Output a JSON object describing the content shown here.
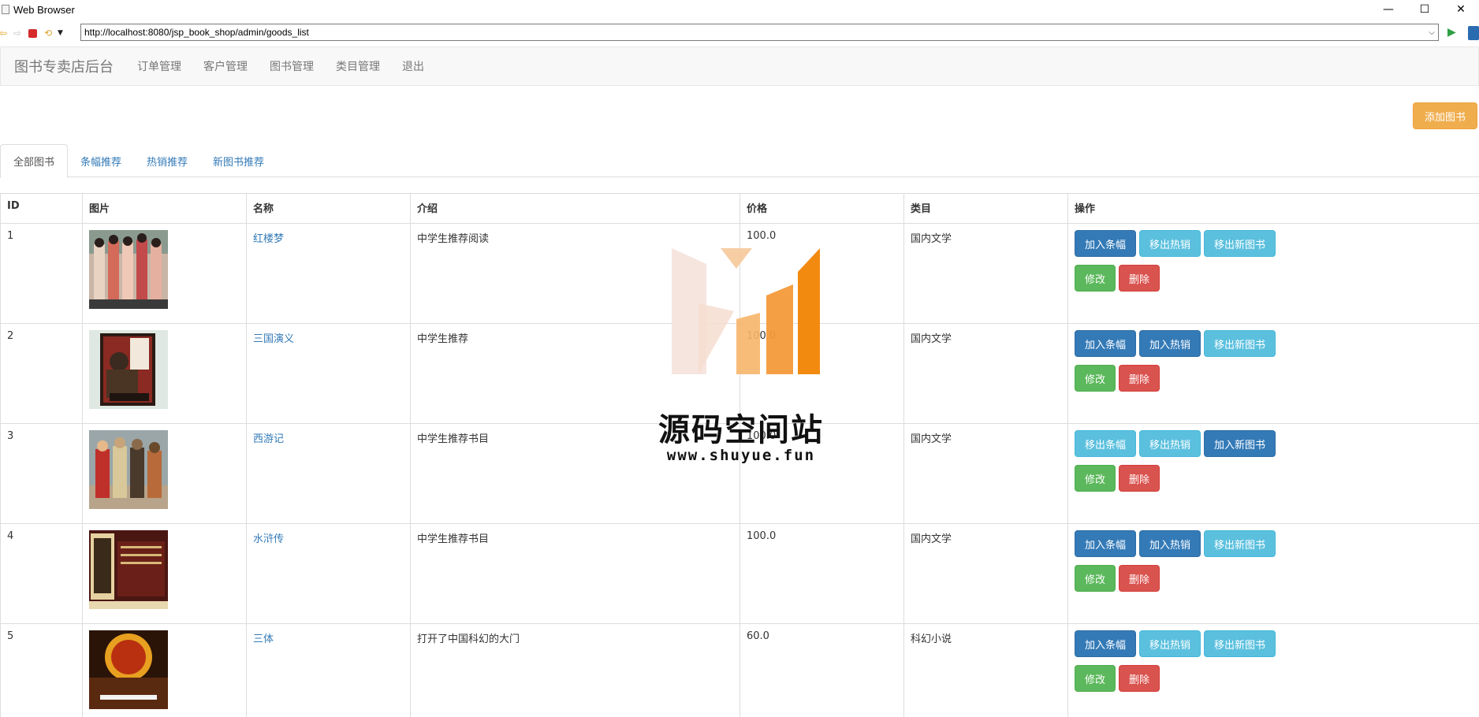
{
  "window": {
    "title": "Web Browser",
    "controls": [
      "—",
      "☐",
      "✕"
    ]
  },
  "browser": {
    "url": "http://localhost:8080/jsp_book_shop/admin/goods_list"
  },
  "navbar": {
    "brand": "图书专卖店后台",
    "links": [
      "订单管理",
      "客户管理",
      "图书管理",
      "类目管理",
      "退出"
    ]
  },
  "actions": {
    "add_book": "添加图书"
  },
  "tabs": [
    "全部图书",
    "条幅推荐",
    "热销推荐",
    "新图书推荐"
  ],
  "table": {
    "headers": [
      "ID",
      "图片",
      "名称",
      "介绍",
      "价格",
      "类目",
      "操作"
    ],
    "rows": [
      {
        "id": "1",
        "name": "红楼梦",
        "intro": "中学生推荐阅读",
        "price": "100.0",
        "category": "国内文学",
        "buttons": [
          "加入条幅",
          "移出热销",
          "移出新图书",
          "修改",
          "删除"
        ]
      },
      {
        "id": "2",
        "name": "三国演义",
        "intro": "中学生推荐",
        "price": "100.0",
        "category": "国内文学",
        "buttons": [
          "加入条幅",
          "加入热销",
          "移出新图书",
          "修改",
          "删除"
        ]
      },
      {
        "id": "3",
        "name": "西游记",
        "intro": "中学生推荐书目",
        "price": "100.0",
        "category": "国内文学",
        "buttons": [
          "移出条幅",
          "移出热销",
          "加入新图书",
          "修改",
          "删除"
        ]
      },
      {
        "id": "4",
        "name": "水浒传",
        "intro": "中学生推荐书目",
        "price": "100.0",
        "category": "国内文学",
        "buttons": [
          "加入条幅",
          "加入热销",
          "移出新图书",
          "修改",
          "删除"
        ]
      },
      {
        "id": "5",
        "name": "三体",
        "intro": "打开了中国科幻的大门",
        "price": "60.0",
        "category": "科幻小说",
        "buttons": [
          "加入条幅",
          "移出热销",
          "移出新图书",
          "修改",
          "删除"
        ]
      }
    ]
  },
  "watermark": {
    "title": "源码空间站",
    "url": "www.shuyue.fun"
  },
  "colors": {
    "primary": "#337ab7",
    "info": "#5bc0de",
    "success": "#5cb85c",
    "danger": "#d9534f",
    "warning": "#f0ad4e",
    "link": "#337ab7"
  }
}
